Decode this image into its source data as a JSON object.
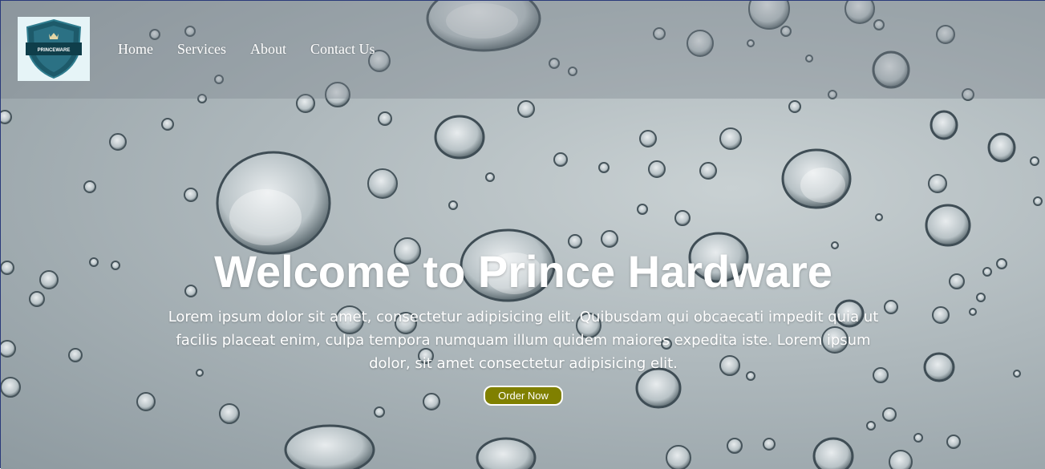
{
  "brand": {
    "logo_text": "PRINCEWARE"
  },
  "nav": {
    "items": [
      {
        "label": "Home"
      },
      {
        "label": "Services"
      },
      {
        "label": "About"
      },
      {
        "label": "Contact Us"
      }
    ]
  },
  "hero": {
    "title": "Welcome to Prince Hardware",
    "description": "Lorem ipsum dolor sit amet, consectetur adipisicing elit. Quibusdam qui obcaecati impedit quia ut facilis placeat enim, culpa tempora numquam illum quidem maiores expedita iste. Lorem ipsum dolor, sit amet consectetur adipisicing elit.",
    "cta_label": "Order Now"
  },
  "colors": {
    "cta_background": "#808000",
    "logo_shield": "#1d5a6a"
  }
}
